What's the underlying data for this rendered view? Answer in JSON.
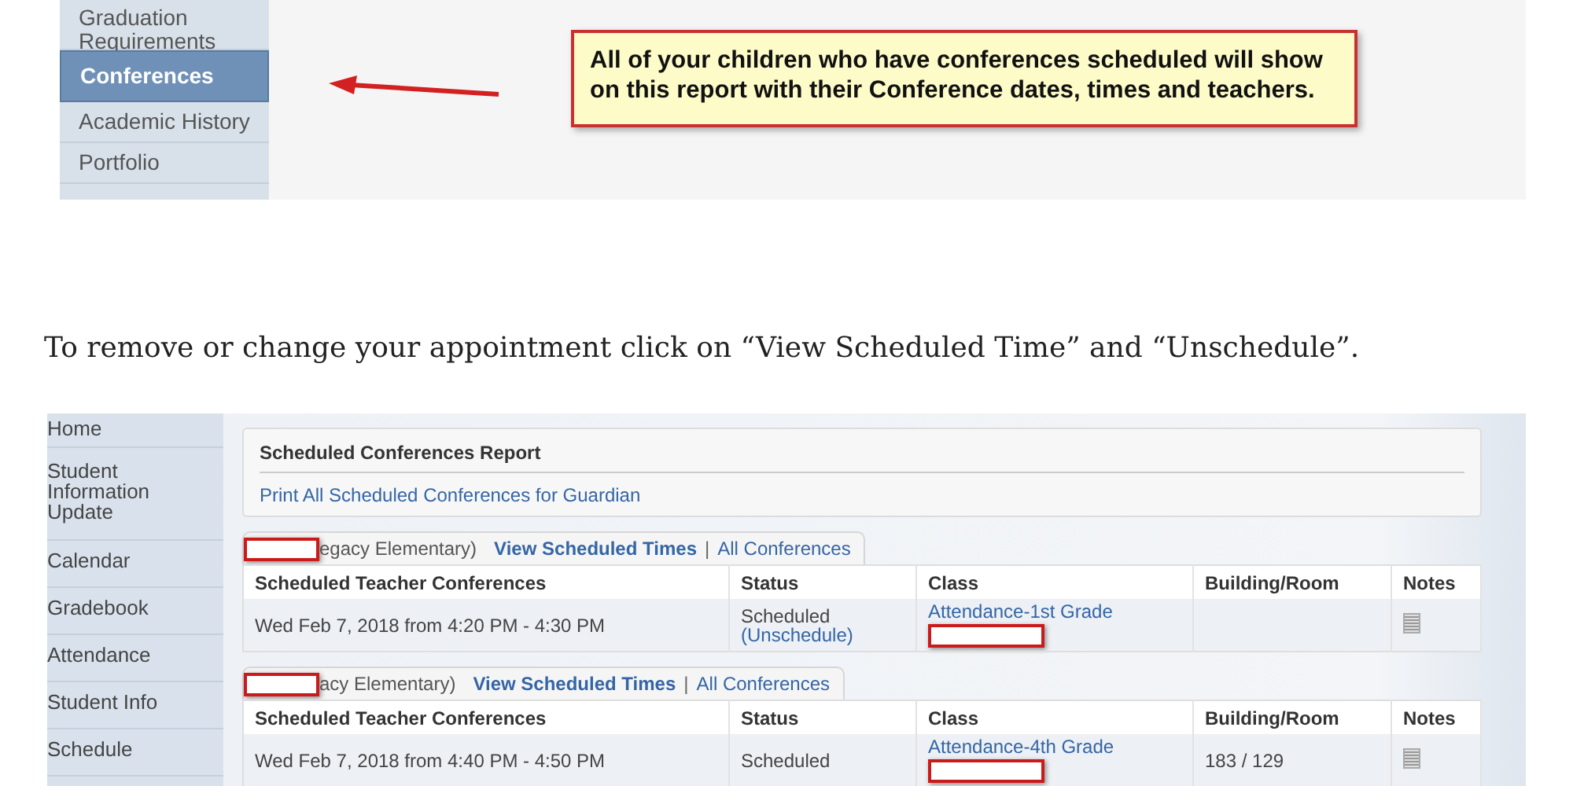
{
  "top_screenshot": {
    "sidebar": [
      {
        "label": "Graduation Requirements",
        "selected": false
      },
      {
        "label": "Conferences",
        "selected": true
      },
      {
        "label": "Academic History",
        "selected": false
      },
      {
        "label": "Portfolio",
        "selected": false
      }
    ],
    "callout": {
      "text": "All of your children who have conferences scheduled will show on this report with their Conference dates, times and teachers."
    }
  },
  "instruction": "To remove or change your appointment click on “View Scheduled Time” and “Unschedule”.",
  "bottom_screenshot": {
    "sidebar": [
      {
        "label": "Home"
      },
      {
        "label": "Student Information Update"
      },
      {
        "label": "Calendar"
      },
      {
        "label": "Gradebook"
      },
      {
        "label": "Attendance"
      },
      {
        "label": "Student Info"
      },
      {
        "label": "Schedule"
      }
    ],
    "report": {
      "title": "Scheduled Conferences Report",
      "link": "Print All Scheduled Conferences for Guardian"
    },
    "sections": [
      {
        "redacted": true,
        "school": "egacy Elementary)",
        "view_link": "View Scheduled Times",
        "separator": "|",
        "all_link": "All Conferences",
        "columns": [
          "Scheduled Teacher Conferences",
          "Status",
          "Class",
          "Building/Room",
          "Notes"
        ],
        "rows": [
          {
            "time": "Wed Feb 7, 2018 from 4:20 PM - 4:30 PM",
            "status": "Scheduled",
            "unschedule": "(Unschedule)",
            "class": "Attendance-1st Grade",
            "class_redacted": true
          }
        ]
      },
      {
        "redacted": true,
        "school": "acy Elementary)",
        "view_link": "View Scheduled Times",
        "separator": "|",
        "all_link": "All Conferences",
        "columns": [
          "Scheduled Teacher Conferences",
          "Status",
          "Class",
          "Building/Room",
          "Notes"
        ],
        "rows": [
          {
            "time": "Wed Feb 7, 2018 from 4:40 PM - 4:50 PM",
            "status": "Scheduled",
            "class": "Attendance-4th Grade",
            "class_redacted": true,
            "room": "183 / 129"
          }
        ]
      }
    ]
  }
}
